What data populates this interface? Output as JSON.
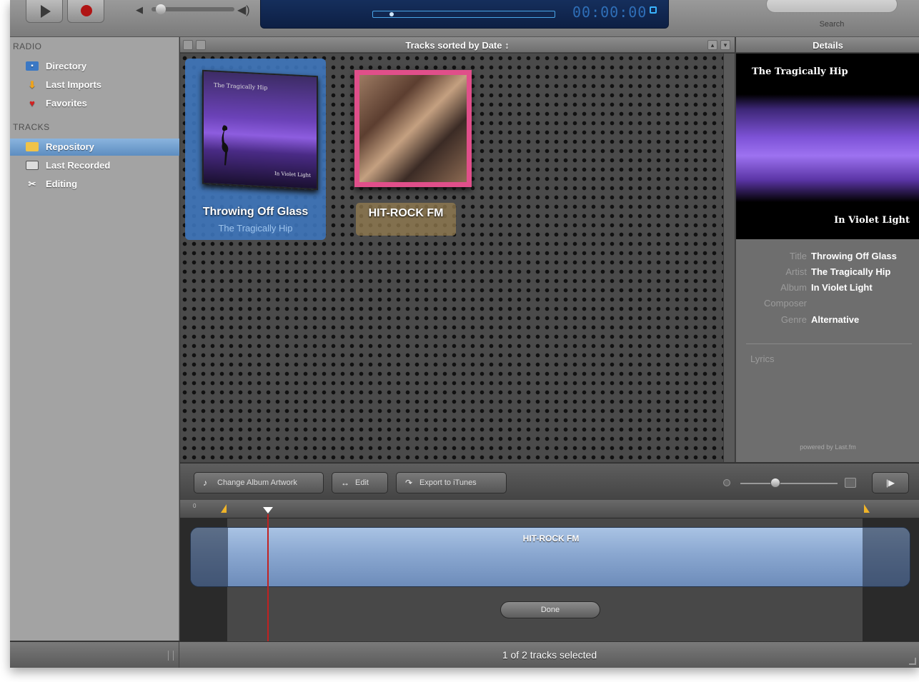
{
  "toolbar": {
    "lcd_time": "00:00:00",
    "search_label": "Search"
  },
  "sidebar": {
    "radio_label": "RADIO",
    "tracks_label": "TRACKS",
    "radio_items": [
      {
        "label": "Directory",
        "icon": "radio-icon"
      },
      {
        "label": "Last Imports",
        "icon": "arrow-down-icon"
      },
      {
        "label": "Favorites",
        "icon": "heart-icon"
      }
    ],
    "track_items": [
      {
        "label": "Repository",
        "icon": "folder-icon",
        "selected": true
      },
      {
        "label": "Last Recorded",
        "icon": "tape-icon"
      },
      {
        "label": "Editing",
        "icon": "scissors-icon"
      }
    ]
  },
  "tracks_header": {
    "title": "Tracks sorted by  Date ↕"
  },
  "tracks": [
    {
      "title": "Throwing Off Glass",
      "artist": "The Tragically Hip",
      "art_title": "The Tragically Hip",
      "art_sub": "In Violet Light",
      "selected": true
    },
    {
      "title": "HIT-ROCK FM",
      "artist": "",
      "selected": false
    }
  ],
  "details": {
    "header": "Details",
    "art_title": "The Tragically Hip",
    "art_sub": "In Violet Light",
    "fields": [
      {
        "key": "Title",
        "value": "Throwing Off Glass"
      },
      {
        "key": "Artist",
        "value": "The Tragically Hip"
      },
      {
        "key": "Album",
        "value": "In Violet Light"
      },
      {
        "key": "Composer",
        "value": ""
      },
      {
        "key": "Genre",
        "value": "Alternative"
      }
    ],
    "lyrics_label": "Lyrics",
    "powered_by": "powered by Last.fm"
  },
  "actions": {
    "change_artwork": "Change Album Artwork",
    "edit": "Edit",
    "export": "Export to iTunes"
  },
  "timeline": {
    "ruler_zero": "0",
    "clip_label": "HIT-ROCK FM",
    "done": "Done"
  },
  "status": {
    "text": "1 of 2 tracks selected"
  },
  "colors": {
    "selection_blue": "#3e76be",
    "record_red": "#b01515",
    "marker_yellow": "#f0b428",
    "playhead_red": "#c02222"
  }
}
